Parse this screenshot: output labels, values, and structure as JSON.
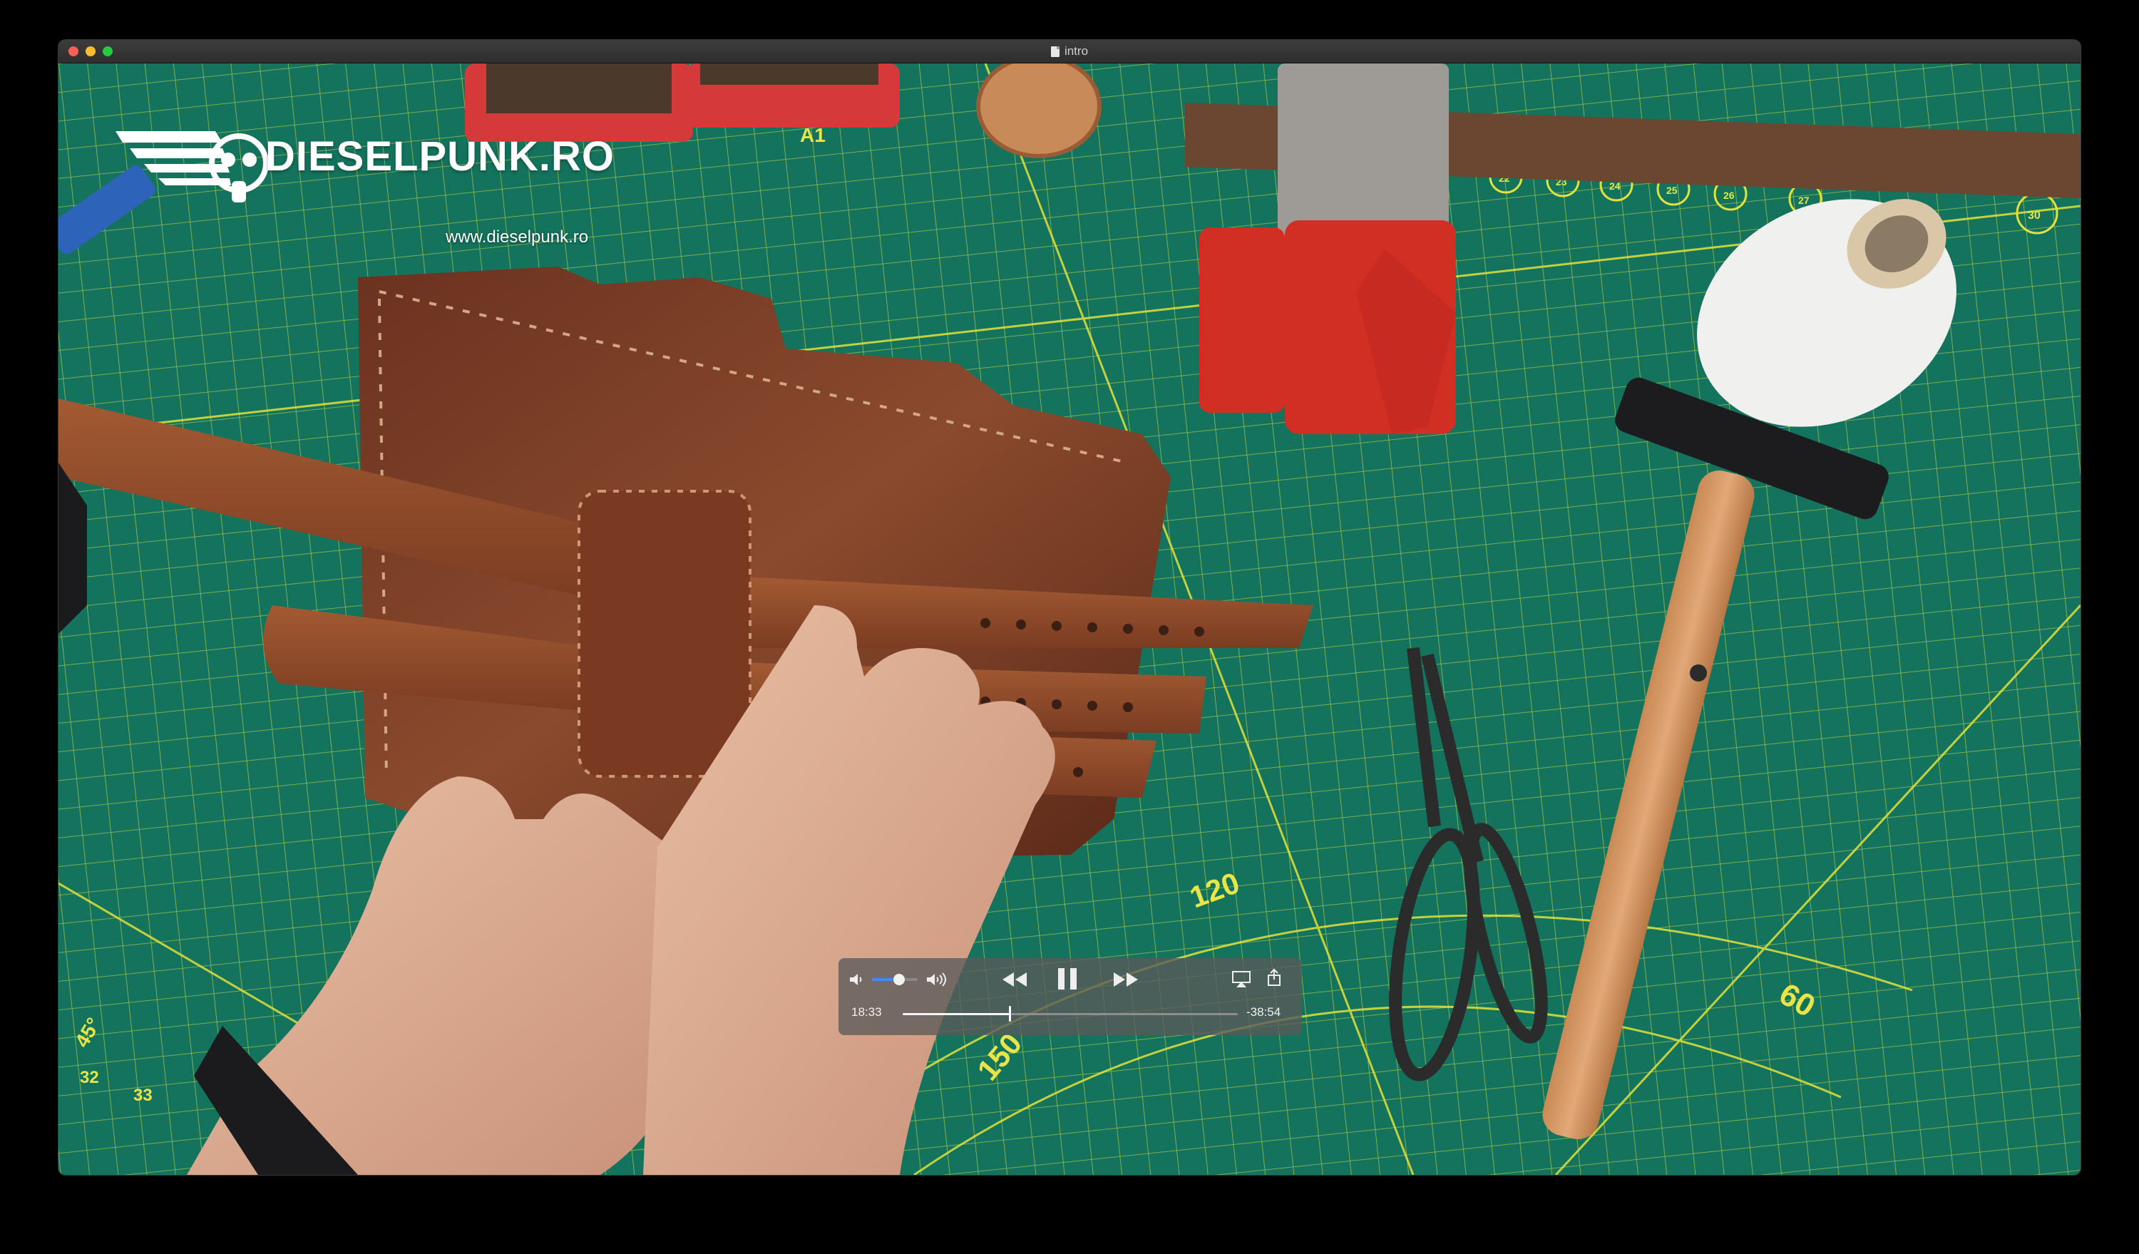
{
  "window": {
    "title": "intro"
  },
  "overlay": {
    "brand_name": "DIESELPUNK.RO",
    "brand_url": "www.dieselpunk.ro"
  },
  "player": {
    "elapsed": "18:33",
    "remaining": "-38:54",
    "progress": 0.32,
    "volume": 0.6,
    "state": "playing",
    "accent_color": "#3d8cff"
  },
  "mat_labels": [
    "A1",
    "120",
    "150",
    "60",
    "22",
    "23",
    "24",
    "25",
    "26",
    "27",
    "30",
    "32",
    "33",
    "45°"
  ]
}
